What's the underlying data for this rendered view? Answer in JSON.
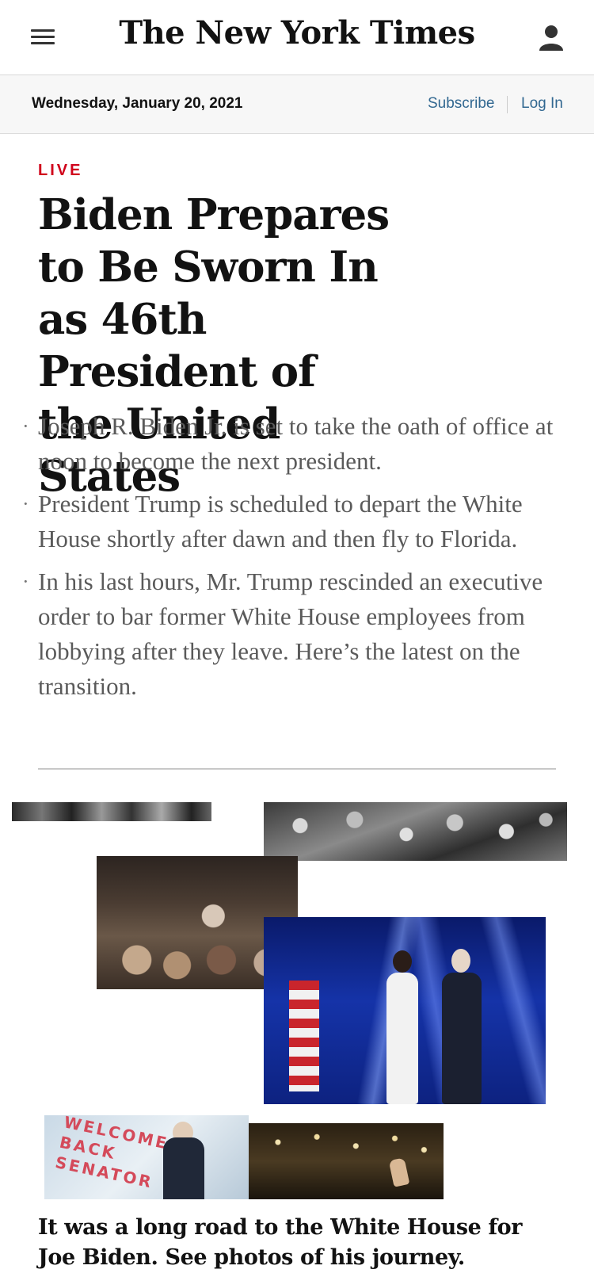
{
  "header": {
    "logo": "The New York Times",
    "menu_icon": "hamburger-menu-icon",
    "account_icon": "user-account-icon"
  },
  "datebar": {
    "date": "Wednesday, January 20, 2021",
    "subscribe": "Subscribe",
    "login": "Log In"
  },
  "article": {
    "label": "LIVE",
    "headline": "Biden Prepares to Be Sworn In as 46th President of the United States",
    "bullets": [
      "Joseph R. Biden Jr. is set to take the oath of office at noon to become the next president.",
      "President Trump is scheduled to depart the White House shortly after dawn and then fly to Florida.",
      "In his last hours, Mr. Trump rescinded an executive order to bar former White House employees from lobbying after they leave. Here’s the latest on the transition."
    ]
  },
  "gallery": {
    "banner_text": "WELCOME BACK SENATOR",
    "caption": "It was a long road to the White House for Joe Biden. See photos of his journey."
  },
  "colors": {
    "live_red": "#d0021b",
    "link_blue": "#326891",
    "headline": "#121212",
    "body_gray": "#5a5a5a"
  }
}
